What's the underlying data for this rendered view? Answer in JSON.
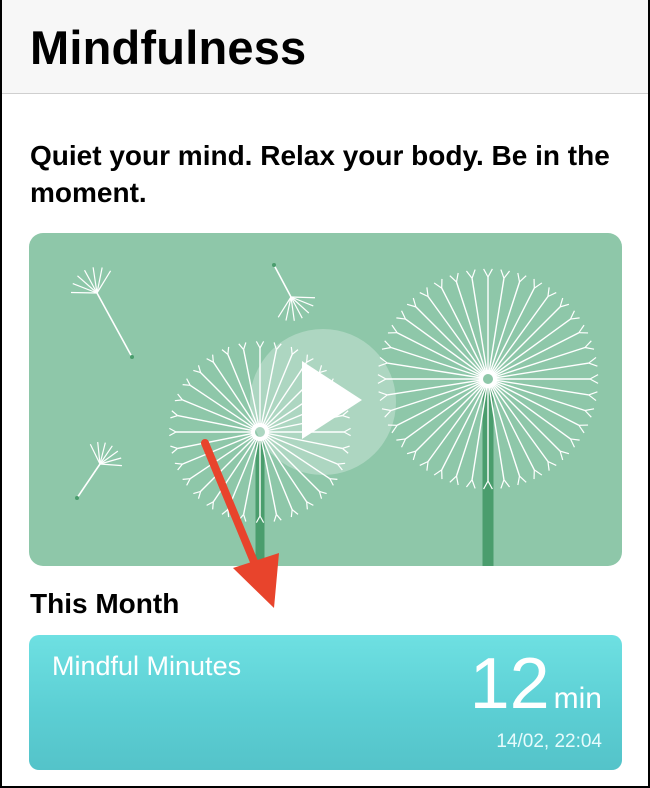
{
  "navbar": {
    "title": "Mindfulness"
  },
  "intro": {
    "tagline": "Quiet your mind. Relax your body. Be in the moment."
  },
  "video": {
    "play_icon": "play-icon",
    "background_color": "#8ec7a9"
  },
  "this_month": {
    "header": "This Month",
    "card": {
      "label": "Mindful Minutes",
      "value": "12",
      "unit": "min",
      "timestamp": "14/02, 22:04",
      "gradient_top": "#6ee0e2",
      "gradient_bottom": "#54c3c9"
    }
  },
  "annotation": {
    "color": "#e8442c",
    "icon": "arrow-annotation-icon"
  }
}
